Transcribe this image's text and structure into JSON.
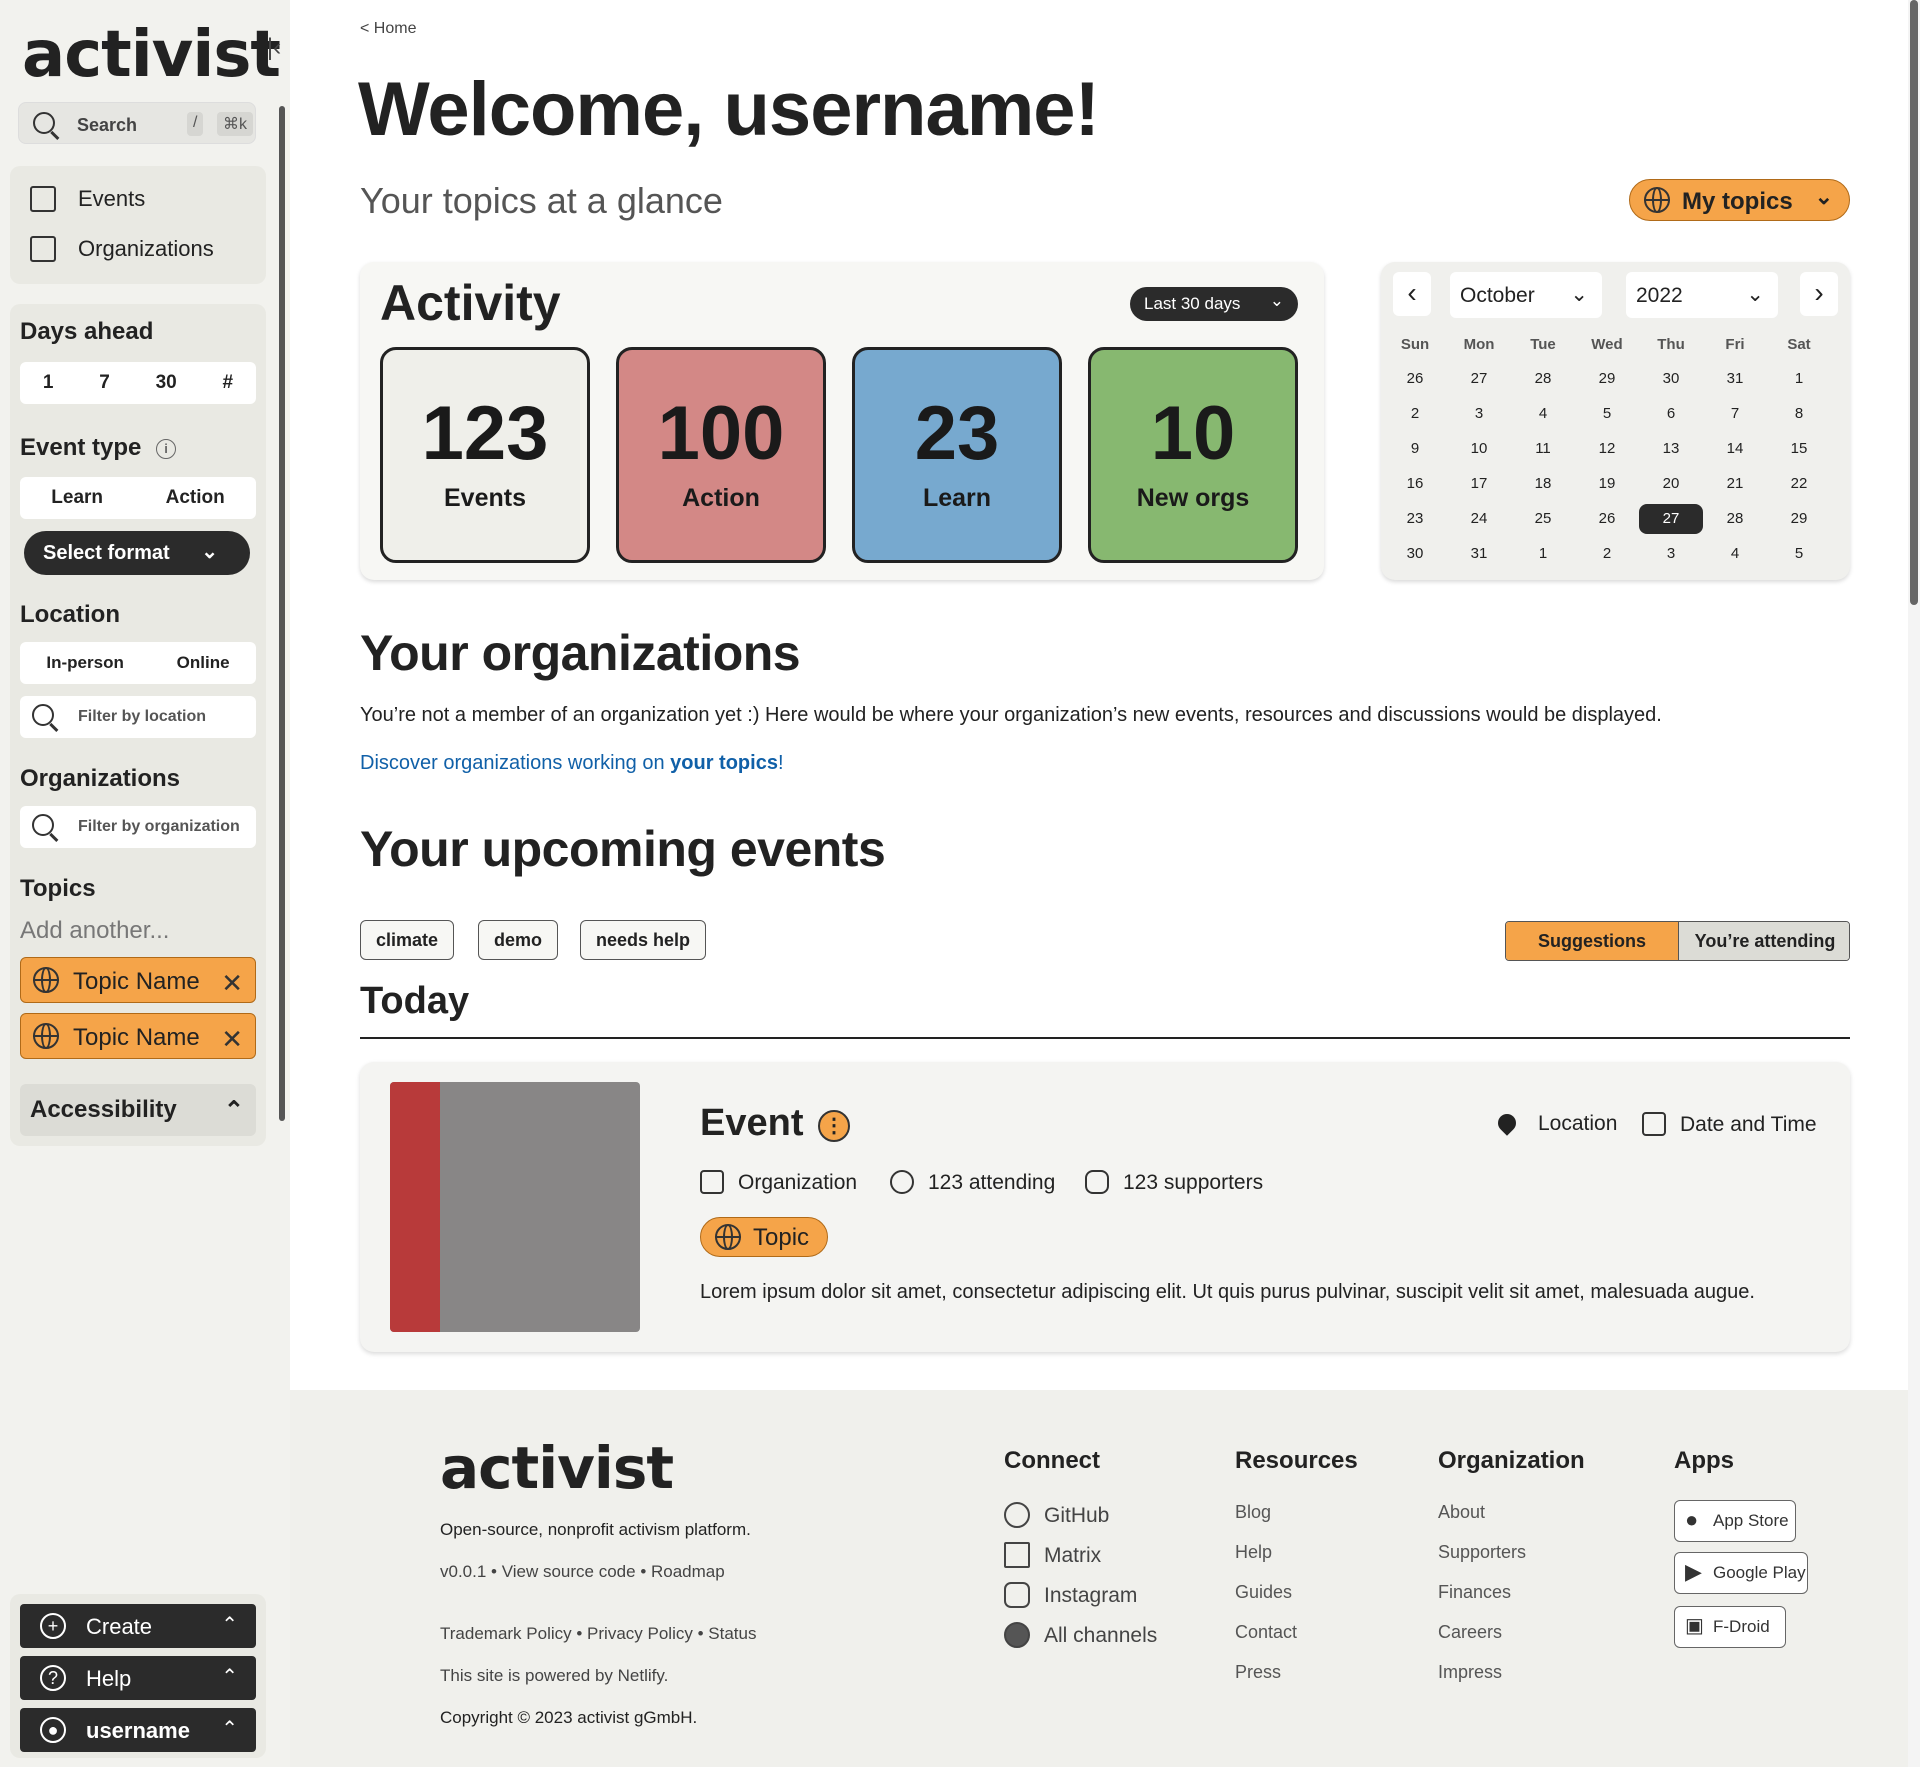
{
  "sidebar": {
    "logo": "activist",
    "collapse_icon": "collapse-left-icon",
    "search": {
      "label": "Search",
      "key1": "/",
      "key2": "⌘k"
    },
    "nav": [
      {
        "label": "Events",
        "icon": "calendar-icon"
      },
      {
        "label": "Organizations",
        "icon": "organization-icon"
      }
    ],
    "days_ahead": {
      "title": "Days ahead",
      "options": [
        "1",
        "7",
        "30",
        "#"
      ]
    },
    "event_type": {
      "title": "Event type",
      "options": [
        "Learn",
        "Action"
      ],
      "select_label": "Select format"
    },
    "location": {
      "title": "Location",
      "options": [
        "In-person",
        "Online"
      ],
      "placeholder": "Filter by location"
    },
    "organizations": {
      "title": "Organizations",
      "placeholder": "Filter by organization"
    },
    "topics": {
      "title": "Topics",
      "add": "Add another...",
      "items": [
        "Topic Name",
        "Topic Name"
      ]
    },
    "accessibility": "Accessibility",
    "bottom": {
      "create": "Create",
      "help": "Help",
      "user": "username"
    }
  },
  "main": {
    "breadcrumb": "< Home",
    "title": "Welcome, username!",
    "subtitle": "Your topics at a glance",
    "my_topics": "My topics",
    "activity": {
      "title": "Activity",
      "range": "Last 30 days",
      "stats": [
        {
          "value": "123",
          "label": "Events",
          "color": "#efefea"
        },
        {
          "value": "100",
          "label": "Action",
          "color": "#d38886"
        },
        {
          "value": "23",
          "label": "Learn",
          "color": "#77a9cf"
        },
        {
          "value": "10",
          "label": "New orgs",
          "color": "#87b870"
        }
      ]
    },
    "calendar": {
      "month": "October",
      "year": "2022",
      "weekdays": [
        "Sun",
        "Mon",
        "Tue",
        "Wed",
        "Thu",
        "Fri",
        "Sat"
      ],
      "days": [
        [
          "26",
          "27",
          "28",
          "29",
          "30",
          "31",
          "1"
        ],
        [
          "2",
          "3",
          "4",
          "5",
          "6",
          "7",
          "8"
        ],
        [
          "9",
          "10",
          "11",
          "12",
          "13",
          "14",
          "15"
        ],
        [
          "16",
          "17",
          "18",
          "19",
          "20",
          "21",
          "22"
        ],
        [
          "23",
          "24",
          "25",
          "26",
          "27",
          "28",
          "29"
        ],
        [
          "30",
          "31",
          "1",
          "2",
          "3",
          "4",
          "5"
        ]
      ],
      "selected_day": "27"
    },
    "orgs": {
      "title": "Your organizations",
      "message": "You’re not a member of an organization yet :) Here would be where your organization’s new events, resources and discussions would be displayed.",
      "link_pre": "Discover organizations working on ",
      "link_bold": "your topics",
      "link_post": "!"
    },
    "events": {
      "title": "Your upcoming events",
      "chips": [
        "climate",
        "demo",
        "needs help"
      ],
      "tabs": [
        "Suggestions",
        "You’re attending"
      ],
      "today": "Today",
      "card": {
        "title": "Event",
        "location": "Location",
        "datetime": "Date and Time",
        "organization": "Organization",
        "attending": "123 attending",
        "supporters": "123 supporters",
        "topic": "Topic",
        "description": "Lorem ipsum dolor sit amet, consectetur adipiscing elit. Ut quis purus pulvinar, suscipit velit sit amet, malesuada augue."
      }
    }
  },
  "footer": {
    "logo": "activist",
    "tagline": "Open-source, nonprofit activism platform.",
    "version": "v0.0.1",
    "source": "View source code",
    "roadmap": "Roadmap",
    "trademark": "Trademark Policy",
    "privacy": "Privacy Policy",
    "status": "Status",
    "powered": "This site is powered by Netlify.",
    "copyright": "Copyright © 2023 activist gGmbH.",
    "connect": {
      "title": "Connect",
      "items": [
        "GitHub",
        "Matrix",
        "Instagram",
        "All channels"
      ]
    },
    "resources": {
      "title": "Resources",
      "items": [
        "Blog",
        "Help",
        "Guides",
        "Contact",
        "Press"
      ]
    },
    "organization": {
      "title": "Organization",
      "items": [
        "About",
        "Supporters",
        "Finances",
        "Careers",
        "Impress"
      ]
    },
    "apps": {
      "title": "Apps",
      "items": [
        "App Store",
        "Google Play",
        "F-Droid"
      ]
    }
  }
}
